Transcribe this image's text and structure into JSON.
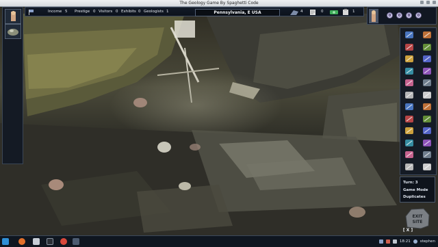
{
  "window": {
    "title": "The Geology Game By Spaghetti Code"
  },
  "stats": {
    "income_label": "Income",
    "income_value": "5",
    "prestige_label": "Prestige",
    "prestige_value": "0",
    "visitors_label": "Visitors",
    "visitors_value": "0",
    "exhibits_label": "Exhibits",
    "exhibits_value": "0",
    "geologists_label": "Geologists",
    "geologists_value": "1",
    "location": "Pennsylvania, E USA",
    "counter_a": "4",
    "counter_b": "0",
    "counter_c": "1"
  },
  "specimens": [
    "0",
    "0",
    "0",
    "0"
  ],
  "turn_panel": {
    "turn": "Turn: 3",
    "mode_label": "Game Mode",
    "mode_value": "Duplicates"
  },
  "exit": {
    "label": "EXIT SITE",
    "close": "[ X ]"
  },
  "taskbar": {
    "time": "18:21",
    "user": "stephen"
  },
  "colors": {
    "panel_bg": "#141a24",
    "panel_border": "#3f4b5f",
    "text": "#e4e8ee",
    "specimen": "#c9c3e6"
  },
  "tools": [
    "hammer-icon",
    "pick-icon",
    "magnifier-icon",
    "book-icon",
    "drill-icon",
    "sample-bag-icon",
    "acid-icon",
    "compass-icon",
    "map-icon",
    "chisel-icon",
    "brush-icon",
    "lamp-icon",
    "gps-icon",
    "helmet-icon",
    "scale-icon",
    "sieve-icon",
    "crate-icon",
    "camera-icon",
    "phone-icon",
    "notes-icon",
    "pen-icon",
    "ruler-icon",
    "star-icon",
    "hat-icon"
  ]
}
